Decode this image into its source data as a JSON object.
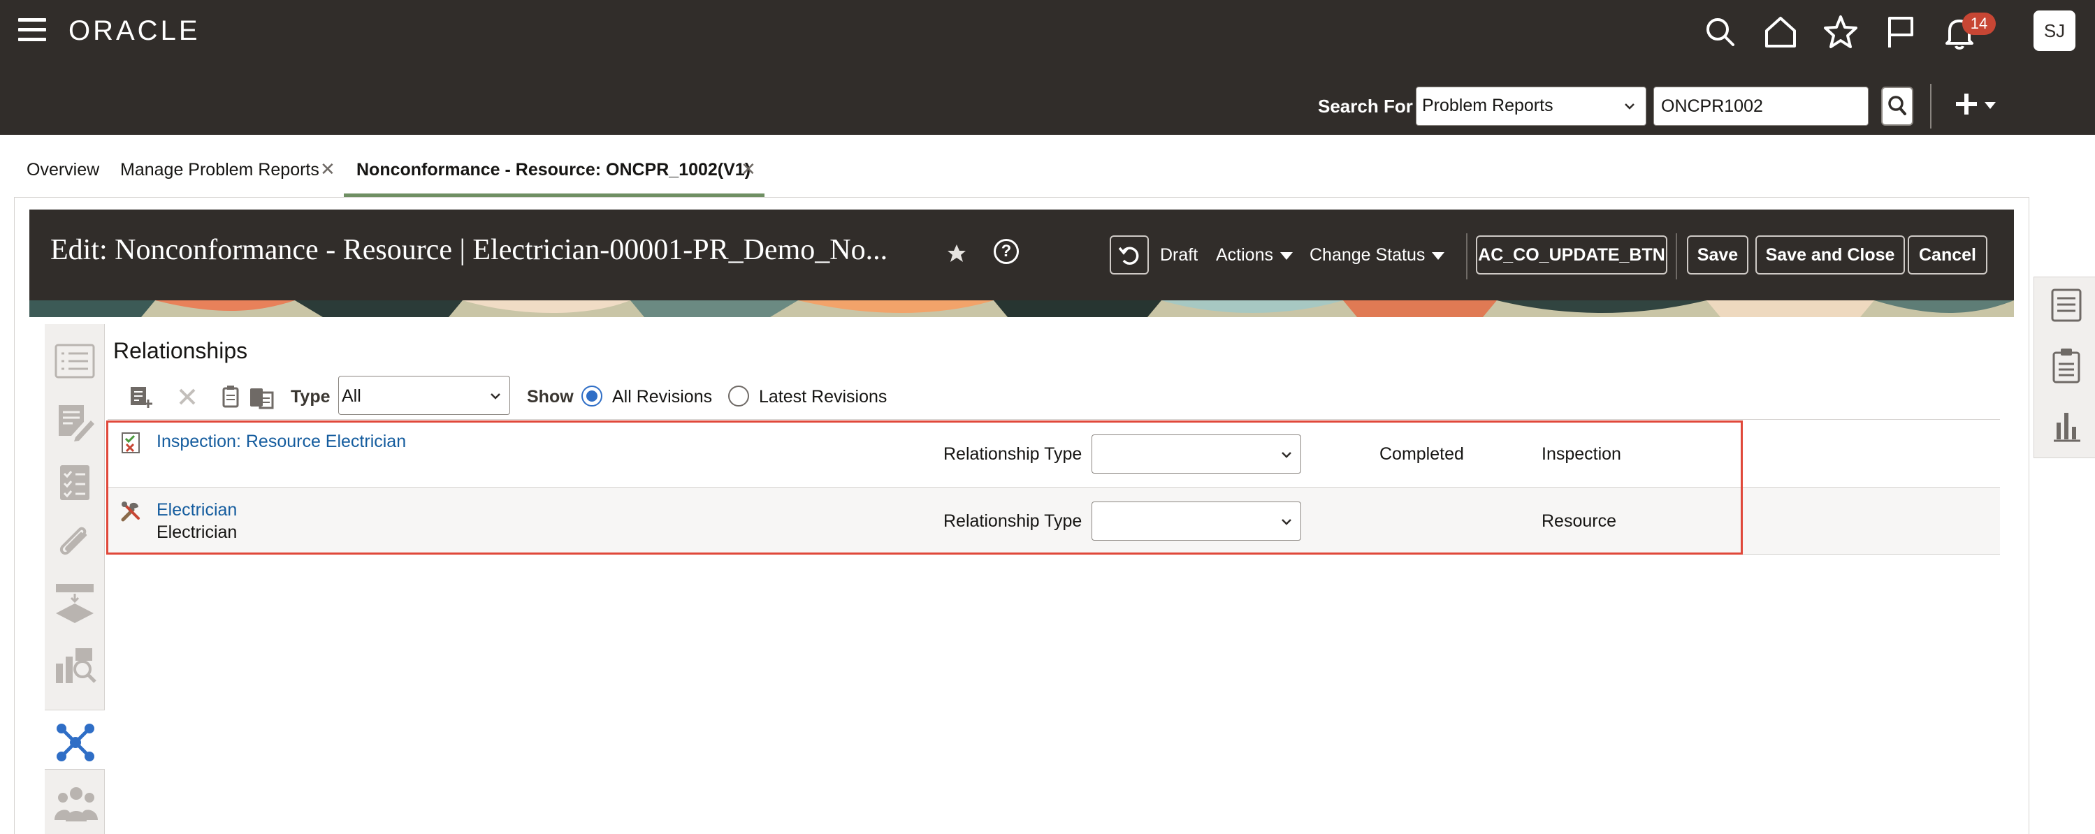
{
  "header": {
    "brand": "ORACLE",
    "notifications_count": "14",
    "user_initials": "SJ",
    "search_label": "Search For",
    "search_category": "Problem Reports",
    "search_value": "ONCPR1002"
  },
  "tabs": [
    {
      "label": "Overview"
    },
    {
      "label": "Manage Problem Reports"
    },
    {
      "label": "Nonconformance - Resource: ONCPR_1002(V1)"
    }
  ],
  "edit": {
    "title": "Edit: Nonconformance - Resource | Electrician-00001-PR_Demo_No...",
    "status": "Draft",
    "actions_label": "Actions",
    "change_status_label": "Change Status",
    "custom_button": "AC_CO_UPDATE_BTN",
    "save_label": "Save",
    "save_close_label": "Save and Close",
    "cancel_label": "Cancel"
  },
  "relationships": {
    "title": "Relationships",
    "type_label": "Type",
    "type_value": "All",
    "show_label": "Show",
    "show_options": [
      "All Revisions",
      "Latest Revisions"
    ],
    "show_selected": "All Revisions",
    "rows": [
      {
        "name": "Inspection: Resource Electrician",
        "sub": "",
        "rel_type_label": "Relationship Type",
        "rel_type_value": "",
        "status": "Completed",
        "object_type": "Inspection"
      },
      {
        "name": "Electrician",
        "sub": "Electrician",
        "rel_type_label": "Relationship Type",
        "rel_type_value": "",
        "status": "",
        "object_type": "Resource"
      }
    ]
  },
  "colors": {
    "header_bg": "#312d2a",
    "link": "#145c9e",
    "active_tab": "#6f8f63",
    "highlight": "#e0483a",
    "radio_selected": "#2f6ec6",
    "badge": "#c74634"
  }
}
